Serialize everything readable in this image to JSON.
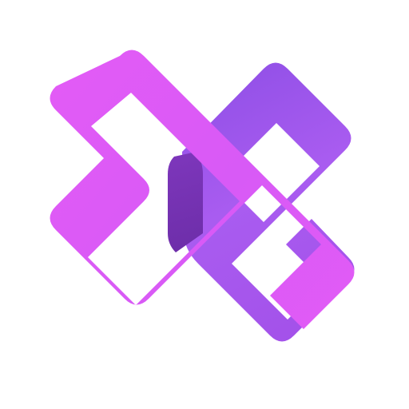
{
  "logo": {
    "name": "x-cross-logo",
    "colors": {
      "primary": "#E25BF6",
      "secondary": "#A95CF0",
      "deep": "#7A34B6",
      "background": "#FFFFFF"
    }
  }
}
